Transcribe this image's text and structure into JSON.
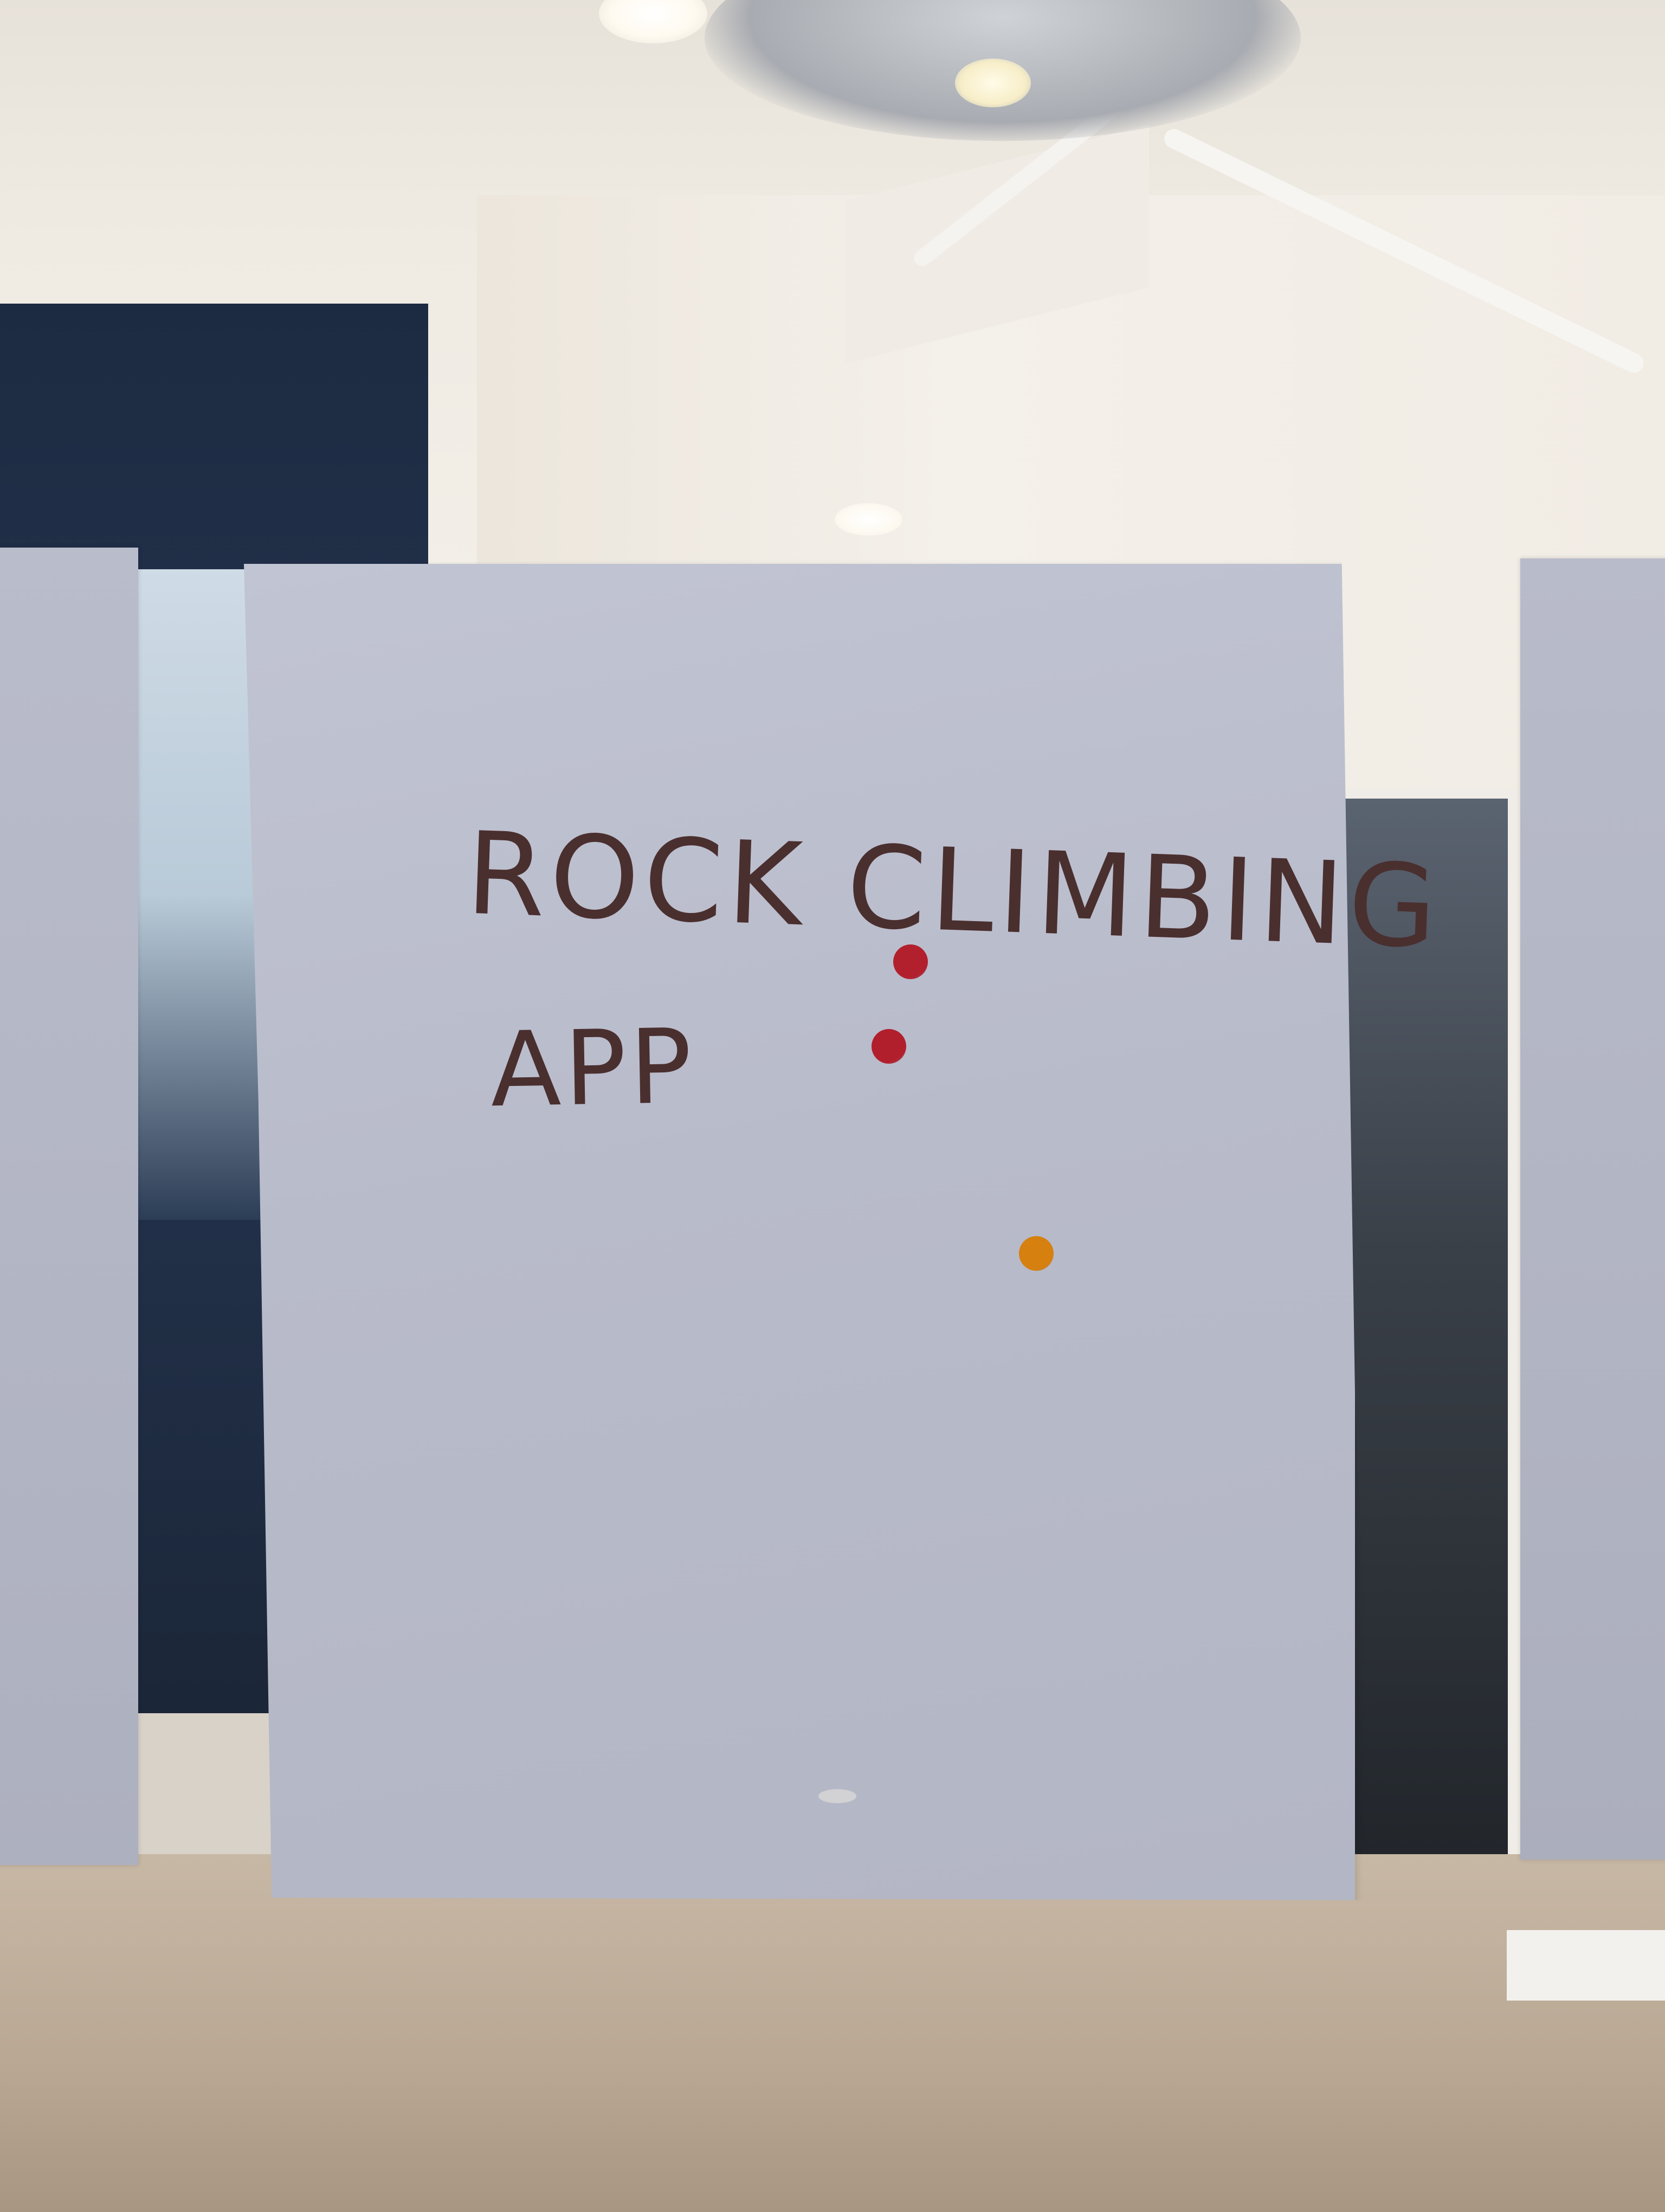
{
  "note": {
    "line1": "ROCK CLIMBING",
    "line2": "APP"
  },
  "dots": [
    {
      "name": "red",
      "color": "#b2202e"
    },
    {
      "name": "red",
      "color": "#b21f2c"
    },
    {
      "name": "orange",
      "color": "#d6800f"
    }
  ]
}
